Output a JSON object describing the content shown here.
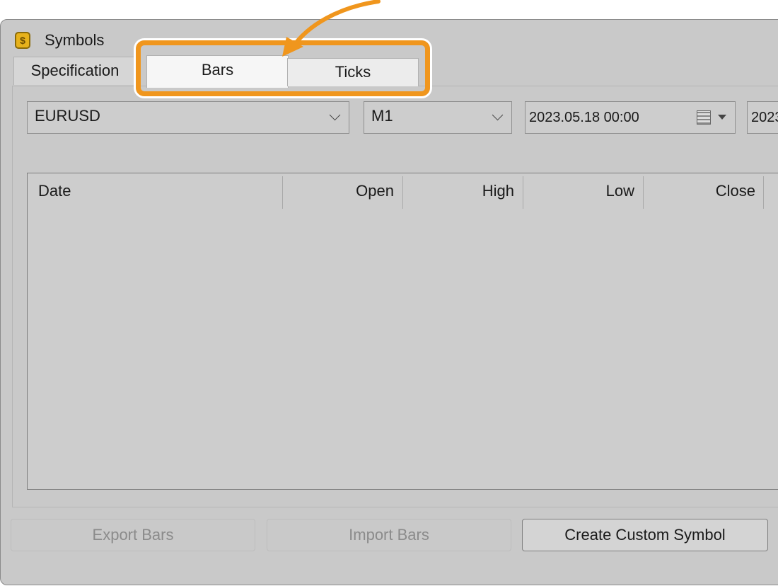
{
  "window": {
    "title": "Symbols",
    "icon": "dollar-symbols-icon"
  },
  "tabs": [
    {
      "label": "Specification"
    },
    {
      "label": "Bars"
    },
    {
      "label": "Ticks"
    }
  ],
  "filters": {
    "symbol": "EURUSD",
    "timeframe": "M1",
    "date_from": "2023.05.18 00:00",
    "date_to": "2023"
  },
  "table": {
    "columns": [
      "Date",
      "Open",
      "High",
      "Low",
      "Close"
    ],
    "rows": []
  },
  "buttons": {
    "export": "Export Bars",
    "import": "Import Bars",
    "create": "Create Custom Symbol"
  },
  "colors": {
    "highlight": "#f0961d"
  }
}
